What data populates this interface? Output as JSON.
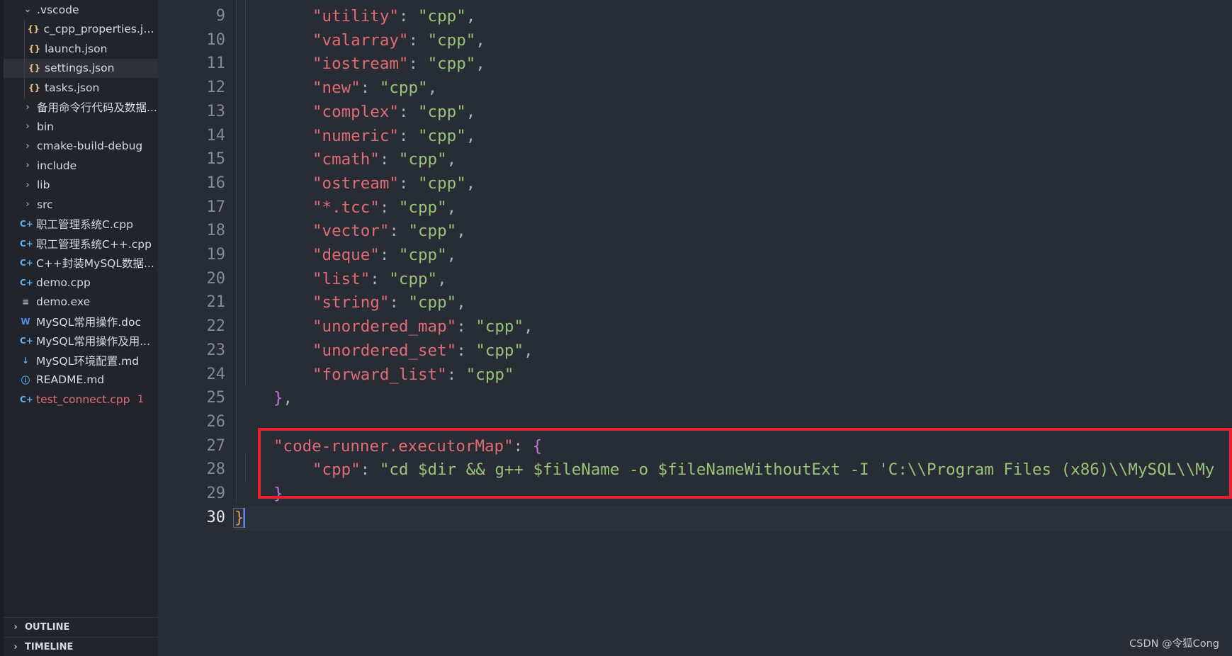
{
  "explorer": {
    "items": [
      {
        "label": ".vscode",
        "chevron": "v",
        "icon": "",
        "indent": 0
      },
      {
        "label": "c_cpp_properties.json",
        "icon": "{}",
        "type": "json",
        "indent": 1
      },
      {
        "label": "launch.json",
        "icon": "{}",
        "type": "json",
        "indent": 1
      },
      {
        "label": "settings.json",
        "icon": "{}",
        "type": "json",
        "indent": 1,
        "selected": true
      },
      {
        "label": "tasks.json",
        "icon": "{}",
        "type": "json",
        "indent": 1
      },
      {
        "label": "备用命令行代码及数据...",
        "chevron": ">",
        "indent": 0
      },
      {
        "label": "bin",
        "chevron": ">",
        "indent": 0
      },
      {
        "label": "cmake-build-debug",
        "chevron": ">",
        "indent": 0
      },
      {
        "label": "include",
        "chevron": ">",
        "indent": 0
      },
      {
        "label": "lib",
        "chevron": ">",
        "indent": 0
      },
      {
        "label": "src",
        "chevron": ">",
        "indent": 0
      },
      {
        "label": "职工管理系统C.cpp",
        "icon": "C+",
        "type": "cpp",
        "indent": 0
      },
      {
        "label": "职工管理系统C++.cpp",
        "icon": "C+",
        "type": "cpp",
        "indent": 0
      },
      {
        "label": "C++封装MySQL数据...",
        "icon": "C+",
        "type": "cpp",
        "indent": 0
      },
      {
        "label": "demo.cpp",
        "icon": "C+",
        "type": "cpp",
        "indent": 0
      },
      {
        "label": "demo.exe",
        "icon": "≡",
        "type": "exe",
        "indent": 0
      },
      {
        "label": "MySQL常用操作.doc",
        "icon": "W",
        "type": "doc",
        "indent": 0
      },
      {
        "label": "MySQL常用操作及用...",
        "icon": "C+",
        "type": "cpp",
        "indent": 0
      },
      {
        "label": "MySQL环境配置.md",
        "icon": "↓",
        "type": "md",
        "indent": 0
      },
      {
        "label": "README.md",
        "icon": "ⓘ",
        "type": "info",
        "indent": 0
      },
      {
        "label": "test_connect.cpp",
        "icon": "C+",
        "type": "cpp",
        "indent": 0,
        "error": true,
        "badge": "1"
      }
    ],
    "outline_label": "OUTLINE",
    "timeline_label": "TIMELINE"
  },
  "editor": {
    "lines": [
      {
        "n": "9",
        "indent": 2,
        "key": "utility",
        "val": "cpp",
        "comma": true
      },
      {
        "n": "10",
        "indent": 2,
        "key": "valarray",
        "val": "cpp",
        "comma": true
      },
      {
        "n": "11",
        "indent": 2,
        "key": "iostream",
        "val": "cpp",
        "comma": true
      },
      {
        "n": "12",
        "indent": 2,
        "key": "new",
        "val": "cpp",
        "comma": true
      },
      {
        "n": "13",
        "indent": 2,
        "key": "complex",
        "val": "cpp",
        "comma": true
      },
      {
        "n": "14",
        "indent": 2,
        "key": "numeric",
        "val": "cpp",
        "comma": true
      },
      {
        "n": "15",
        "indent": 2,
        "key": "cmath",
        "val": "cpp",
        "comma": true
      },
      {
        "n": "16",
        "indent": 2,
        "key": "ostream",
        "val": "cpp",
        "comma": true
      },
      {
        "n": "17",
        "indent": 2,
        "key": "*.tcc",
        "val": "cpp",
        "comma": true
      },
      {
        "n": "18",
        "indent": 2,
        "key": "vector",
        "val": "cpp",
        "comma": true
      },
      {
        "n": "19",
        "indent": 2,
        "key": "deque",
        "val": "cpp",
        "comma": true
      },
      {
        "n": "20",
        "indent": 2,
        "key": "list",
        "val": "cpp",
        "comma": true
      },
      {
        "n": "21",
        "indent": 2,
        "key": "string",
        "val": "cpp",
        "comma": true
      },
      {
        "n": "22",
        "indent": 2,
        "key": "unordered_map",
        "val": "cpp",
        "comma": true
      },
      {
        "n": "23",
        "indent": 2,
        "key": "unordered_set",
        "val": "cpp",
        "comma": true
      },
      {
        "n": "24",
        "indent": 2,
        "key": "forward_list",
        "val": "cpp",
        "comma": false
      },
      {
        "n": "25",
        "indent": 1,
        "raw": "},"
      },
      {
        "n": "26",
        "indent": 0,
        "raw": ""
      },
      {
        "n": "27",
        "indent": 1,
        "key": "code-runner.executorMap",
        "open": "{"
      },
      {
        "n": "28",
        "indent": 2,
        "key": "cpp",
        "val": "cd $dir && g++ $fileName -o $fileNameWithoutExt -I 'C:\\\\Program Files (x86)\\\\MySQL\\\\My",
        "comma": false,
        "unterminated": true
      },
      {
        "n": "29",
        "indent": 1,
        "raw": "}",
        "bracket": "purple"
      },
      {
        "n": "30",
        "indent": 0,
        "raw": "}",
        "bracket": "gold",
        "active": true
      }
    ]
  },
  "watermark": "CSDN @令狐Cong",
  "colors": {
    "key": "#e06c75",
    "string": "#98c379",
    "highlight_box": "#e8212d",
    "sidebar_bg": "#21252b",
    "editor_bg": "#282c34"
  }
}
